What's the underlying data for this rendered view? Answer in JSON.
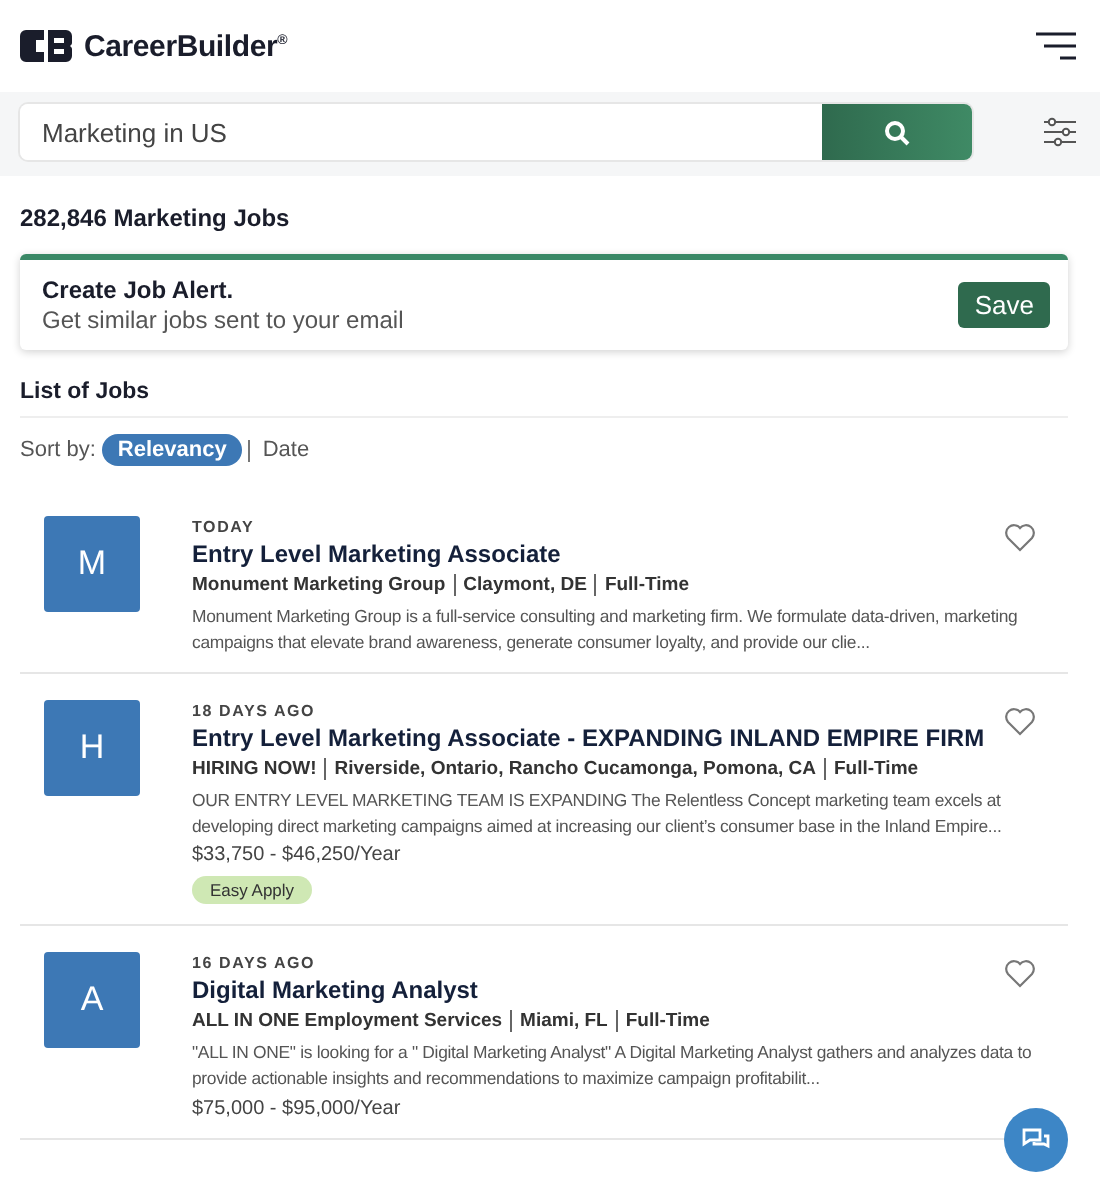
{
  "header": {
    "brand": "CareerBuilder$^{®}$"
  },
  "search": {
    "value": "Marketing in US"
  },
  "results_count": "282,846 Marketing Jobs",
  "job_alert": {
    "title": "Create Job Alert.",
    "subtitle": "Get similar jobs sent to your email",
    "button": "Save"
  },
  "list_heading": "List of Jobs",
  "sort": {
    "label": "Sort by:",
    "options": [
      {
        "label": "Relevancy",
        "selected": true
      },
      {
        "label": "Date",
        "selected": false
      }
    ]
  },
  "jobs": [
    {
      "initial": "M",
      "posted": "TODAY",
      "title": "Entry Level Marketing Associate",
      "company": "Monument Marketing Group",
      "location": "Claymont, DE",
      "type": "Full-Time",
      "description": "Monument Marketing Group is a full-service consulting and marketing firm. We formulate data-driven, marketing campaigns that elevate brand awareness, generate consumer loyalty, and provide our clie...",
      "saved": false
    },
    {
      "initial": "H",
      "posted": "18 DAYS AGO",
      "title": "Entry Level Marketing Associate - EXPANDING INLAND EMPIRE FIRM",
      "company": "HIRING NOW!",
      "location": "Riverside, Ontario, Rancho Cucamonga, Pomona, CA",
      "type": "Full-Time",
      "description": "OUR ENTRY LEVEL MARKETING TEAM IS EXPANDING The Relentless Concept marketing team excels at developing direct marketing campaigns aimed at increasing our client’s consumer base in the Inland Empire...",
      "salary": "$33,750 - $46,250/Year",
      "badge": "Easy Apply",
      "saved": false
    },
    {
      "initial": "A",
      "posted": "16 DAYS AGO",
      "title": "Digital Marketing Analyst",
      "company": "ALL IN ONE Employment Services",
      "location": "Miami, FL",
      "type": "Full-Time",
      "description": "\"ALL IN ONE\" is looking for a \" Digital Marketing Analyst\" A Digital Marketing Analyst gathers and analyzes data to provide actionable insights and recommendations to maximize campaign profitabilit...",
      "salary": "$75,000 - $95,000/Year",
      "saved": false
    }
  ]
}
